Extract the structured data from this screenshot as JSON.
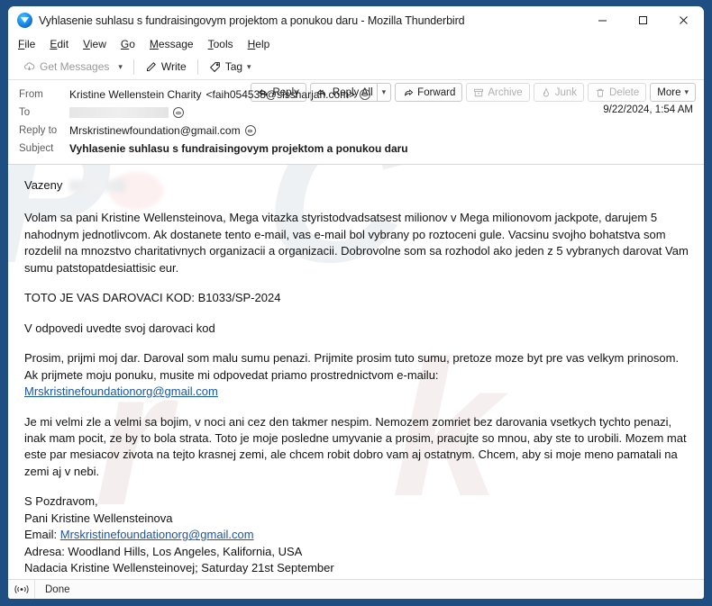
{
  "window": {
    "title": "Vyhlasenie suhlasu s fundraisingovym projektom a ponukou daru - Mozilla Thunderbird",
    "minimize_label": "Minimize",
    "maximize_label": "Maximize",
    "close_label": "Close"
  },
  "menubar": [
    {
      "label": "File",
      "accel": "F"
    },
    {
      "label": "Edit",
      "accel": "E"
    },
    {
      "label": "View",
      "accel": "V"
    },
    {
      "label": "Go",
      "accel": "G"
    },
    {
      "label": "Message",
      "accel": "M"
    },
    {
      "label": "Tools",
      "accel": "T"
    },
    {
      "label": "Help",
      "accel": "H"
    }
  ],
  "toolbar": {
    "get_messages": "Get Messages",
    "write": "Write",
    "tag": "Tag"
  },
  "header": {
    "from_label": "From",
    "from_name": "Kristine Wellenstein Charity",
    "from_address": "<faih054538@sissharjah.com>",
    "to_label": "To",
    "to_value": "",
    "reply_to_label": "Reply to",
    "reply_to_value": "Mrskristinewfoundation@gmail.com",
    "subject_label": "Subject",
    "subject_value": "Vyhlasenie suhlasu s fundraisingovym projektom a ponukou daru",
    "timestamp": "9/22/2024, 1:54 AM"
  },
  "actions": {
    "reply": "Reply",
    "reply_all": "Reply All",
    "forward": "Forward",
    "archive": "Archive",
    "junk": "Junk",
    "delete": "Delete",
    "more": "More"
  },
  "body": {
    "greeting": "Vazeny",
    "paragraph1": "Volam sa pani Kristine Wellensteinova, Mega vitazka styristodvadsatsest milionov v Mega milionovom jackpote, darujem 5 nahodnym jednotlivcom. Ak dostanete tento e-mail, vas e-mail bol vybrany po roztoceni gule. Vacsinu svojho bohatstva som rozdelil na mnozstvo charitativnych organizacii a organizacii. Dobrovolne som sa rozhodol ako jeden z 5 vybranych darovat Vam sumu patstopatdesiattisic eur.",
    "paragraph2": "TOTO JE VAS DAROVACI KOD: B1033/SP-2024",
    "paragraph3": "V odpovedi uvedte svoj darovaci kod",
    "paragraph4": "Prosim, prijmi moj dar. Daroval som malu sumu penazi. Prijmite prosim tuto sumu, pretoze moze byt pre vas velkym prinosom. Ak prijmete moju ponuku, musite mi odpovedat priamo prostrednictvom e-mailu:",
    "link1": "Mrskristinefoundationorg@gmail.com",
    "paragraph5": "Je mi velmi zle a velmi sa bojim, v noci ani cez den takmer nespim. Nemozem zomriet bez darovania vsetkych tychto penazi, inak mam pocit, ze by to bola strata. Toto je moje posledne umyvanie a prosim, pracujte so mnou, aby ste to urobili. Mozem mat este par mesiacov zivota na tejto krasnej zemi, ale chcem robit dobro vam aj ostatnym. Chcem, aby si moje meno pamatali na zemi aj v nebi.",
    "sign_off": "S Pozdravom,",
    "sign_name": "Pani Kristine Wellensteinova",
    "sign_email_label": "Email:",
    "sign_email": "Mrskristinefoundationorg@gmail.com",
    "sign_address": "Adresa: Woodland Hills, Los Angeles, Kalifornia, USA",
    "sign_foundation": "Nadacia Kristine Wellensteinovej; Saturday 21st September"
  },
  "statusbar": {
    "status_text": "Done"
  },
  "colors": {
    "window_frame": "#1f4f82",
    "link": "#1a55a8",
    "text": "#121212"
  },
  "watermark": {
    "text_a": "PC",
    "text_b": "risk"
  }
}
